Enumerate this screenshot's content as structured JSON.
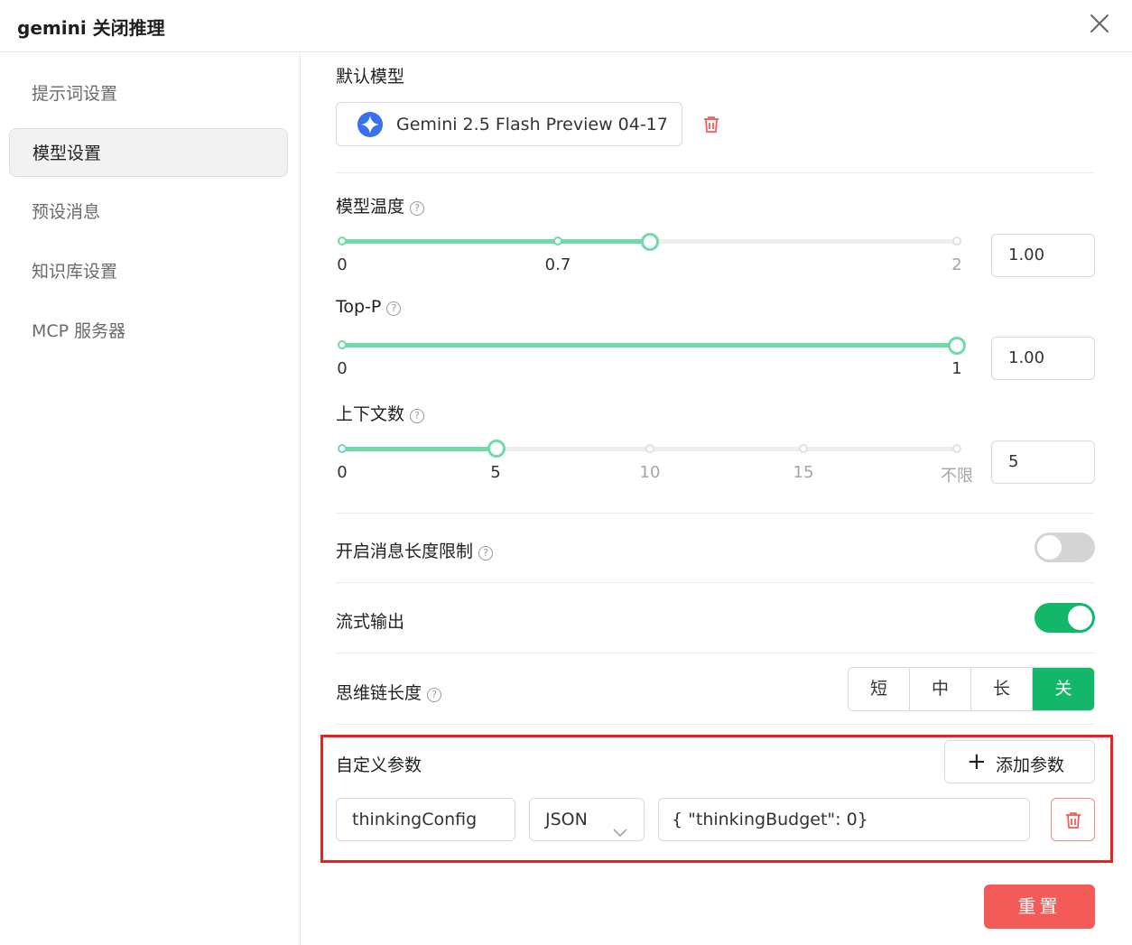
{
  "window": {
    "title": "gemini 关闭推理"
  },
  "sidebar": {
    "items": [
      {
        "label": "提示词设置"
      },
      {
        "label": "模型设置"
      },
      {
        "label": "预设消息"
      },
      {
        "label": "知识库设置"
      },
      {
        "label": "MCP 服务器"
      }
    ],
    "active_index": 1
  },
  "default_model": {
    "label": "默认模型",
    "name": "Gemini 2.5 Flash Preview 04-17",
    "icon": "gemini-star-icon"
  },
  "temperature": {
    "label": "模型温度",
    "value_text": "1.00",
    "value": 1.0,
    "min": 0,
    "max": 2,
    "marks": [
      "0",
      "0.7",
      "2"
    ]
  },
  "top_p": {
    "label": "Top-P",
    "value_text": "1.00",
    "value": 1.0,
    "min": 0,
    "max": 1,
    "marks": [
      "0",
      "1"
    ]
  },
  "context_count": {
    "label": "上下文数",
    "value_text": "5",
    "value": 5,
    "marks": [
      "0",
      "5",
      "10",
      "15",
      "不限"
    ]
  },
  "message_length_limit": {
    "label": "开启消息长度限制",
    "enabled": false
  },
  "stream_output": {
    "label": "流式输出",
    "enabled": true
  },
  "reasoning_length": {
    "label": "思维链长度",
    "options": [
      "短",
      "中",
      "长",
      "关"
    ],
    "selected": "关"
  },
  "custom_params": {
    "label": "自定义参数",
    "add_label": "添加参数",
    "rows": [
      {
        "name": "thinkingConfig",
        "type": "JSON",
        "value": "{  \"thinkingBudget\": 0}"
      }
    ]
  },
  "reset_label": "重置",
  "colors": {
    "accent": "#12b76a",
    "slider": "#6fdba6",
    "danger": "#f25b57",
    "highlight_frame": "#e8221c"
  }
}
